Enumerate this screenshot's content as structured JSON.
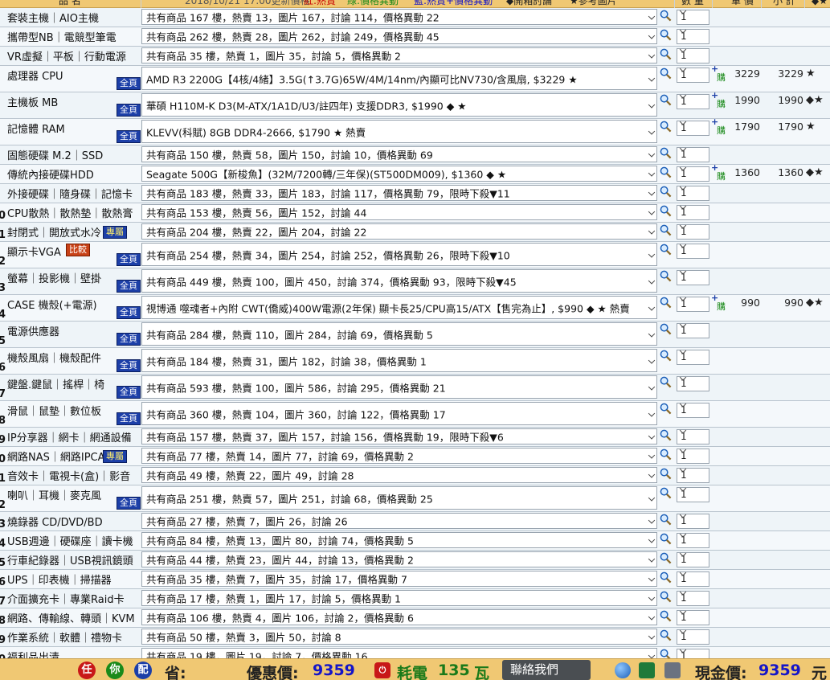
{
  "header": {
    "col_name": "品 名",
    "date_note": "2018/10/21 17:00更新價格",
    "legend_red": "紅:熱賣",
    "legend_green": "綠:價格異動",
    "legend_blue": "藍:熱賣+價格異動",
    "legend_discuss": "◆開箱討論",
    "legend_photo": "★參考圖片",
    "col_qty": "數 量",
    "col_unit": "單 價",
    "col_sub": "小 計",
    "col_mark": "◆★"
  },
  "rows": [
    {
      "num": "",
      "category": "套裝主機｜AIO主機",
      "text": "共有商品 167 樓，熱賣 13，圖片 167，討論 114，價格異動 22",
      "qty": "1"
    },
    {
      "num": "",
      "category": "攜帶型NB｜電競型筆電",
      "text": "共有商品 262 樓，熱賣 28，圖片 262，討論 249，價格異動 45",
      "qty": "1"
    },
    {
      "num": "",
      "category": "VR虛擬｜平板｜行動電源",
      "text": "共有商品 35 樓，熱賣 1，圖片 35，討論 5，價格異動 2",
      "qty": "1"
    },
    {
      "num": "",
      "category": "處理器 CPU",
      "tag": "全頁",
      "text": "AMD R3 2200G【4核/4緒】3.5G(↑3.7G)65W/4M/14nm/內顯可比NV730/含風扇, $3229 ★",
      "qty": "1",
      "cart": "購",
      "unit": "3229",
      "sub": "3229",
      "marks": "★"
    },
    {
      "num": "",
      "category": "主機板 MB",
      "tag": "全頁",
      "text": "華碩 H110M-K D3(M-ATX/1A1D/U3/註四年) 支援DDR3, $1990 ◆ ★",
      "qty": "1",
      "cart": "購",
      "unit": "1990",
      "sub": "1990",
      "marks": "◆★"
    },
    {
      "num": "",
      "category": "記憶體 RAM",
      "tag": "全頁",
      "text": "KLEVV(科賦) 8GB DDR4-2666, $1790 ★ 熱賣",
      "qty": "1",
      "cart": "購",
      "unit": "1790",
      "sub": "1790",
      "marks": "★"
    },
    {
      "num": "",
      "category": "固態硬碟 M.2｜SSD",
      "text": "共有商品 150 樓，熱賣 58，圖片 150，討論 10，價格異動 69",
      "qty": "1"
    },
    {
      "num": "",
      "category": "傳統內接硬碟HDD",
      "text": "Seagate 500G【新梭魚】(32M/7200轉/三年保)(ST500DM009), $1360 ◆ ★",
      "qty": "1",
      "cart": "購",
      "unit": "1360",
      "sub": "1360",
      "marks": "◆★"
    },
    {
      "num": "",
      "category": "外接硬碟｜隨身碟｜記憶卡",
      "text": "共有商品 183 樓，熱賣 33，圖片 183，討論 117，價格異動 79，限時下殺▼11",
      "qty": "1"
    },
    {
      "num": "0",
      "category": "CPU散熱｜散熱墊｜散熱膏",
      "text": "共有商品 153 樓，熱賣 56，圖片 152，討論 44",
      "qty": "1"
    },
    {
      "num": "1",
      "category": "封閉式｜開放式水冷",
      "tag2": "專屬",
      "text": "共有商品 204 樓，熱賣 22，圖片 204，討論 22",
      "qty": "1"
    },
    {
      "num": "2",
      "category": "顯示卡VGA",
      "cmp": "比較",
      "tag": "全頁",
      "text": "共有商品 254 樓，熱賣 34，圖片 254，討論 252，價格異動 26，限時下殺▼10",
      "qty": "1"
    },
    {
      "num": "3",
      "category": "螢幕｜投影機｜壁掛",
      "tag": "全頁",
      "text": "共有商品 449 樓，熱賣 100，圖片 450，討論 374，價格異動 93，限時下殺▼45",
      "qty": "1"
    },
    {
      "num": "4",
      "category": "CASE 機殼(+電源)",
      "tag": "全頁",
      "text": "視博通 噬魂者+內附 CWT(僑威)400W電源(2年保) 顯卡長25/CPU高15/ATX【售完為止】, $990 ◆ ★ 熱賣",
      "qty": "1",
      "cart": "購",
      "unit": "990",
      "sub": "990",
      "marks": "◆★"
    },
    {
      "num": "5",
      "category": "電源供應器",
      "tag": "全頁",
      "text": "共有商品 284 樓，熱賣 110，圖片 284，討論 69，價格異動 5",
      "qty": "1"
    },
    {
      "num": "6",
      "category": "機殼風扇｜機殼配件",
      "tag": "全頁",
      "text": "共有商品 184 樓，熱賣 31，圖片 182，討論 38，價格異動 1",
      "qty": "1"
    },
    {
      "num": "7",
      "category": "鍵盤.鍵鼠｜搖桿｜椅",
      "tag": "全頁",
      "text": "共有商品 593 樓，熱賣 100，圖片 586，討論 295，價格異動 21",
      "qty": "1"
    },
    {
      "num": "8",
      "category": "滑鼠｜鼠墊｜數位板",
      "tag": "全頁",
      "text": "共有商品 360 樓，熱賣 104，圖片 360，討論 122，價格異動 17",
      "qty": "1"
    },
    {
      "num": "9",
      "category": "IP分享器｜網卡｜網通設備",
      "text": "共有商品 157 樓，熱賣 37，圖片 157，討論 156，價格異動 19，限時下殺▼6",
      "qty": "1"
    },
    {
      "num": "0",
      "category": "網路NAS｜網路IPCAM",
      "tag2": "專屬",
      "text": "共有商品 77 樓，熱賣 14，圖片 77，討論 69，價格異動 2",
      "qty": "1"
    },
    {
      "num": "1",
      "category": "音效卡｜電視卡(盒)｜影音",
      "text": "共有商品 49 樓，熱賣 22，圖片 49，討論 28",
      "qty": "1"
    },
    {
      "num": "2",
      "category": "喇叭｜耳機｜麥克風",
      "tag": "全頁",
      "text": "共有商品 251 樓，熱賣 57，圖片 251，討論 68，價格異動 25",
      "qty": "1"
    },
    {
      "num": "3",
      "category": "燒錄器 CD/DVD/BD",
      "text": "共有商品 27 樓，熱賣 7，圖片 26，討論 26",
      "qty": "1"
    },
    {
      "num": "4",
      "category": "USB週邊｜硬碟座｜讀卡機",
      "text": "共有商品 84 樓，熱賣 13，圖片 80，討論 74，價格異動 5",
      "qty": "1"
    },
    {
      "num": "5",
      "category": "行車紀錄器｜USB視訊鏡頭",
      "text": "共有商品 44 樓，熱賣 23，圖片 44，討論 13，價格異動 2",
      "qty": "1"
    },
    {
      "num": "6",
      "category": "UPS｜印表機｜掃描器",
      "text": "共有商品 35 樓，熱賣 7，圖片 35，討論 17，價格異動 7",
      "qty": "1"
    },
    {
      "num": "7",
      "category": "介面擴充卡｜專業Raid卡",
      "text": "共有商品 17 樓，熱賣 1，圖片 17，討論 5，價格異動 1",
      "qty": "1"
    },
    {
      "num": "8",
      "category": "網路、傳輸線、轉頭｜KVM",
      "text": "共有商品 106 樓，熱賣 4，圖片 106，討論 2，價格異動 6",
      "qty": "1"
    },
    {
      "num": "9",
      "category": "作業系統｜軟體｜禮物卡",
      "text": "共有商品 50 樓，熱賣 3，圖片 50，討論 8",
      "qty": "1"
    },
    {
      "num": "0",
      "category": "福利品出清",
      "text": "共有商品 19 樓，圖片 19，討論 7，價格異動 16",
      "qty": "1"
    }
  ],
  "footer": {
    "btn1": "任",
    "btn2": "你",
    "btn3": "配",
    "save_label": "省:",
    "discount_label": "優惠價:",
    "discount_value": "9359",
    "power_label": "耗電",
    "power_value": "135",
    "power_unit": "瓦",
    "contact": "聯絡我們",
    "cash_label": "現金價:",
    "cash_value": "9359",
    "cash_unit": "元"
  },
  "colors": {
    "accent": "#1c3fa8",
    "header_bg": "#f0c873",
    "price_blue": "#1515c8",
    "power_green": "#1a7a1a"
  }
}
